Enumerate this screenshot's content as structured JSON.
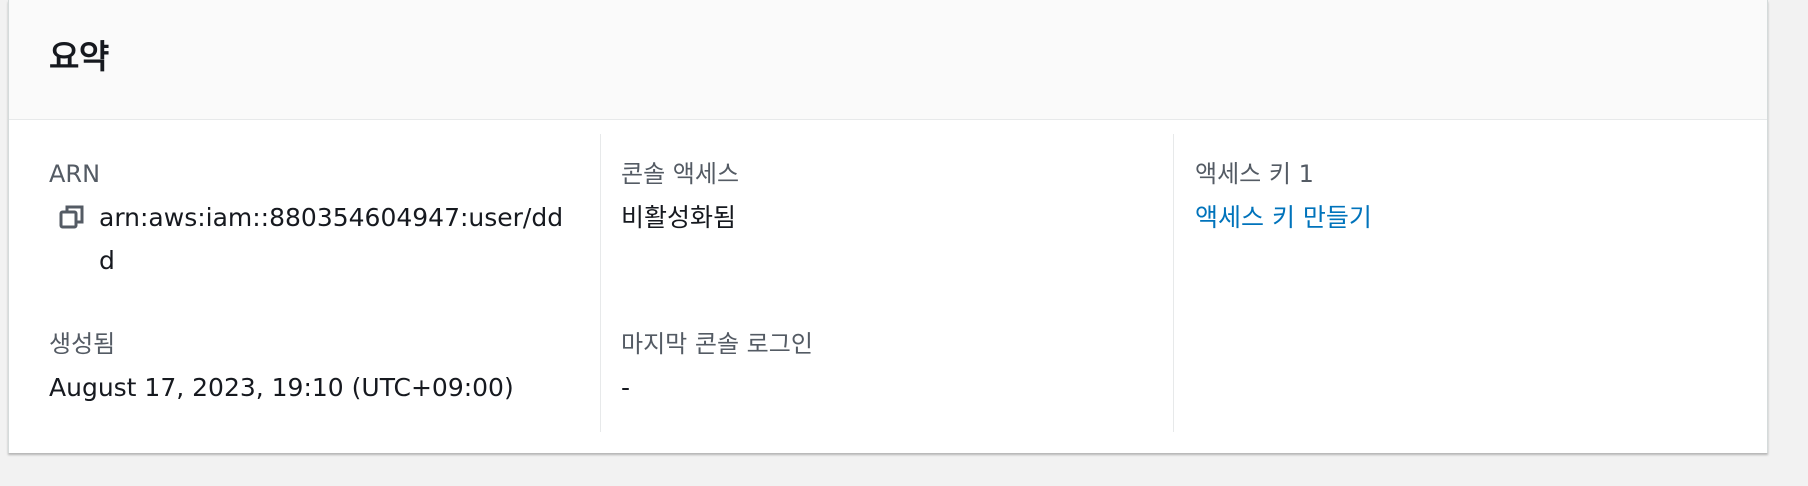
{
  "summary": {
    "title": "요약",
    "arn": {
      "label": "ARN",
      "value": "arn:aws:iam::880354604947:user/ddd",
      "icon": "copy-icon"
    },
    "created": {
      "label": "생성됨",
      "value": "August 17, 2023, 19:10 (UTC+09:00)"
    },
    "console_access": {
      "label": "콘솔 액세스",
      "value": "비활성화됨"
    },
    "last_console_login": {
      "label": "마지막 콘솔 로그인",
      "value": "-"
    },
    "access_key": {
      "label": "액세스 키 1",
      "link": "액세스 키 만들기"
    }
  },
  "colors": {
    "link": "#0073bb",
    "label": "#545b64",
    "text": "#16191f"
  }
}
